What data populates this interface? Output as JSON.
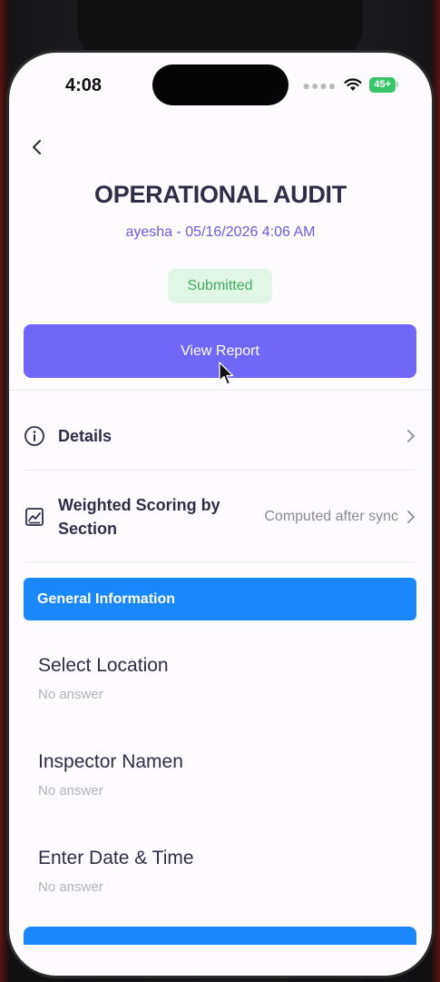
{
  "status_bar": {
    "time": "4:08",
    "battery": "45+"
  },
  "header": {
    "title": "OPERATIONAL AUDIT",
    "subtitle": "ayesha  - 05/16/2026 4:06 AM",
    "status_badge": "Submitted"
  },
  "actions": {
    "view_report_label": "View Report"
  },
  "rows": {
    "details": {
      "label": "Details"
    },
    "weighted": {
      "label": "Weighted Scoring by Section",
      "value": "Computed after sync"
    }
  },
  "section": {
    "title": "General Information"
  },
  "questions": [
    {
      "label": "Select Location",
      "answer": "No answer"
    },
    {
      "label": "Inspector Namen",
      "answer": "No answer"
    },
    {
      "label": "Enter Date & Time",
      "answer": "No answer"
    }
  ],
  "colors": {
    "accent": "#7167f6",
    "section_blue": "#1a87fb",
    "success_bg": "#e2f6e8",
    "success_text": "#3fae62",
    "title_text": "#2e2e48"
  },
  "icons": [
    "back-chevron-icon",
    "wifi-icon",
    "battery-icon",
    "info-icon",
    "chart-icon",
    "chevron-right-icon",
    "mouse-cursor-icon"
  ]
}
